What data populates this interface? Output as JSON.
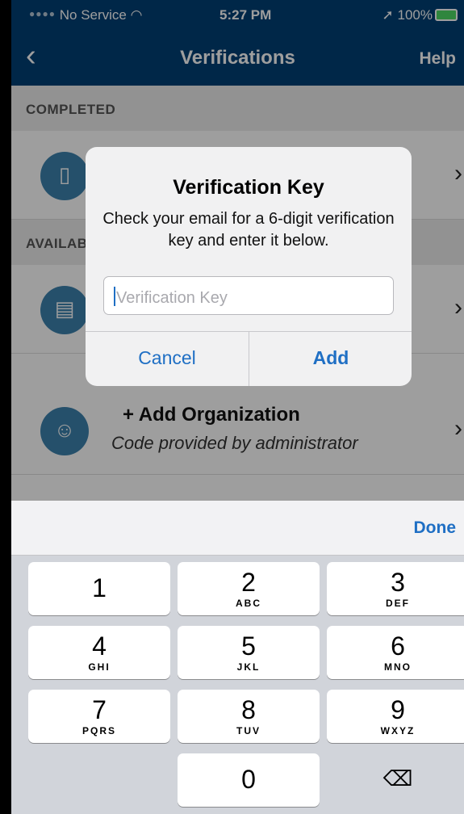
{
  "status_bar": {
    "carrier": "No Service",
    "time": "5:27 PM",
    "battery": "100%"
  },
  "nav": {
    "back_icon": "chevron-left-icon",
    "title": "Verifications",
    "help": "Help"
  },
  "sections": {
    "completed": "COMPLETED",
    "available": "AVAILABLE"
  },
  "organization_row": {
    "title": "+ Add Organization",
    "subtitle": "Code provided by administrator"
  },
  "alert": {
    "title": "Verification Key",
    "message": "Check your email for a 6-digit verification key and enter it below.",
    "input_placeholder": "Verification Key",
    "input_value": "",
    "cancel": "Cancel",
    "add": "Add"
  },
  "keyboard": {
    "done": "Done",
    "keys": [
      {
        "num": "1",
        "letters": ""
      },
      {
        "num": "2",
        "letters": "ABC"
      },
      {
        "num": "3",
        "letters": "DEF"
      },
      {
        "num": "4",
        "letters": "GHI"
      },
      {
        "num": "5",
        "letters": "JKL"
      },
      {
        "num": "6",
        "letters": "MNO"
      },
      {
        "num": "7",
        "letters": "PQRS"
      },
      {
        "num": "8",
        "letters": "TUV"
      },
      {
        "num": "9",
        "letters": "WXYZ"
      },
      {
        "num": "0",
        "letters": ""
      }
    ],
    "delete_icon": "backspace-icon"
  },
  "colors": {
    "nav_bg": "#003f74",
    "accent": "#1f6fc4",
    "icon_circle": "#3d82ad"
  }
}
